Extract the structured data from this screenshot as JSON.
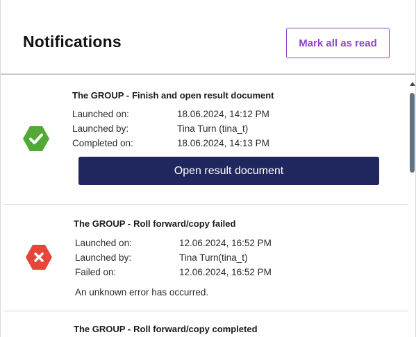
{
  "header": {
    "title": "Notifications",
    "mark_all_label": "Mark all as read"
  },
  "notifications": [
    {
      "group": "The GROUP -",
      "title": "Finish and open result document",
      "status": "success",
      "status_icon": "check-icon",
      "status_color": "#52a935",
      "fields": [
        {
          "label": "Launched on:",
          "value": "18.06.2024, 14:12 PM"
        },
        {
          "label": "Launched by:",
          "value": "Tina Turn (tina_t)"
        },
        {
          "label": "Completed on:",
          "value": "18.06.2024, 14:13 PM"
        }
      ],
      "action_label": "Open result document"
    },
    {
      "group": "The GROUP -",
      "title": "Roll forward/copy failed",
      "status": "error",
      "status_icon": "close-icon",
      "status_color": "#e8443a",
      "fields": [
        {
          "label": "Launched on:",
          "value": "12.06.2024, 16:52 PM"
        },
        {
          "label": "Launched by:",
          "value": "Tina Turn(tina_t)"
        },
        {
          "label": "Failed on:",
          "value": "12.06.2024, 16:52 PM"
        }
      ],
      "message": "An unknown error has occurred."
    },
    {
      "group": "The GROUP -",
      "title": "Roll forward/copy completed"
    }
  ],
  "colors": {
    "accent": "#8e44c9",
    "primary_button": "#20275e",
    "scroll_thumb": "#5d7384"
  }
}
